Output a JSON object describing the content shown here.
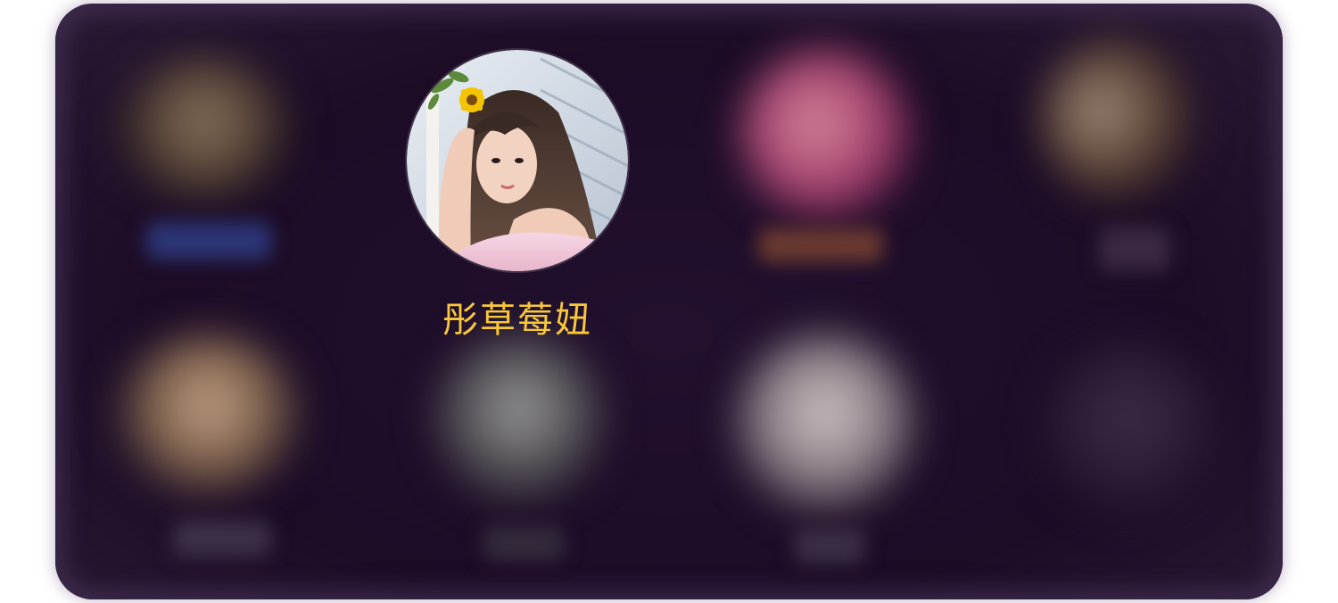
{
  "featured_user": {
    "name": "彤草莓妞"
  },
  "colors": {
    "panel_bg": "#1c0c26",
    "name_color": "#f9c83a"
  }
}
